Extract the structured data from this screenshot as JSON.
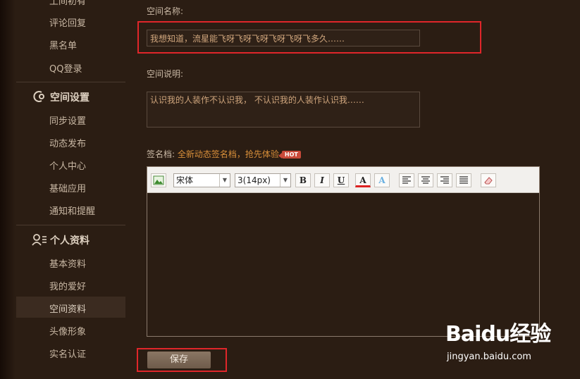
{
  "sidebar": {
    "top_items": [
      {
        "label": "土间初有"
      },
      {
        "label": "评论回复"
      },
      {
        "label": "黑名单"
      },
      {
        "label": "QQ登录"
      }
    ],
    "section_space": {
      "title": "空间设置",
      "icon": "space-settings-icon",
      "items": [
        {
          "label": "同步设置"
        },
        {
          "label": "动态发布"
        },
        {
          "label": "个人中心"
        },
        {
          "label": "基础应用"
        },
        {
          "label": "通知和提醒"
        }
      ]
    },
    "section_profile": {
      "title": "个人资料",
      "icon": "profile-icon",
      "items": [
        {
          "label": "基本资料"
        },
        {
          "label": "我的爱好"
        },
        {
          "label": "空间资料",
          "active": true
        },
        {
          "label": "头像形象"
        },
        {
          "label": "实名认证"
        }
      ]
    }
  },
  "form": {
    "name_label": "空间名称:",
    "name_value": "我想知道，流星能飞呀飞呀飞呀飞呀飞呀飞多久……",
    "desc_label": "空间说明:",
    "desc_value": "认识我的人装作不认识我， 不认识我的人装作认识我……",
    "sig_label": "签名档:",
    "sig_link": "全新动态签名档，抢先体验",
    "hot_badge": "HOT"
  },
  "editor": {
    "font_value": "宋体",
    "size_value": "3(14px)",
    "bold": "B",
    "italic": "I",
    "underline": "U",
    "font_color": "A",
    "highlight": "A"
  },
  "save_label": "保存",
  "watermark": {
    "brand": "Baidu经验",
    "url": "jingyan.baidu.com"
  },
  "colors": {
    "background": "#2b1d13",
    "highlight_box": "#e0262a",
    "link": "#d98f3a"
  }
}
